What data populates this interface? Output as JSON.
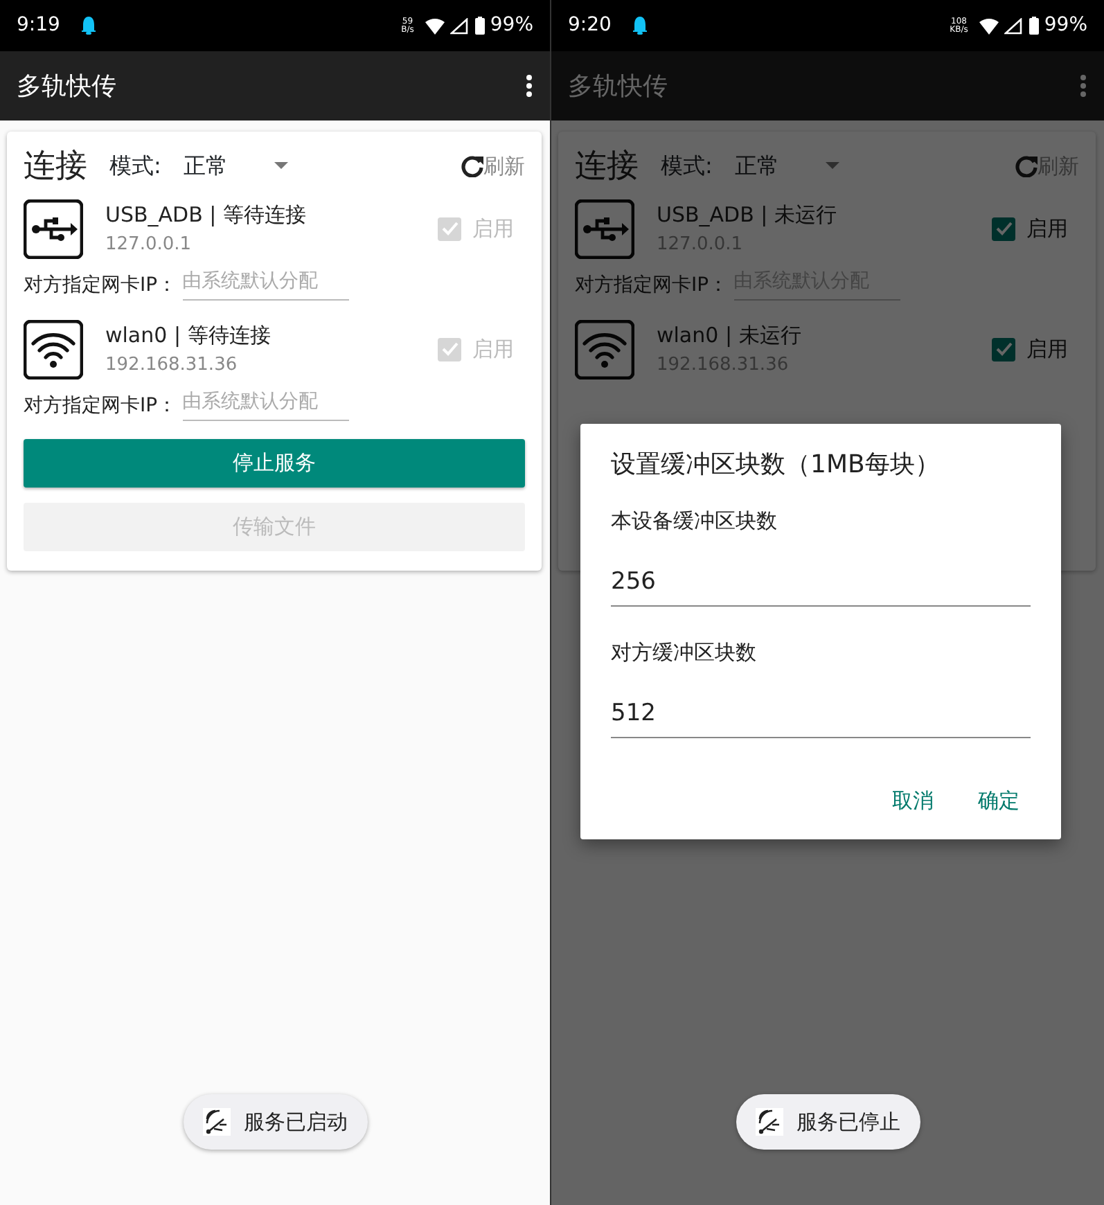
{
  "screens": [
    {
      "status_bar": {
        "time": "9:19",
        "speed": "59",
        "speed_unit": "B/s",
        "battery": "99%"
      },
      "app_bar": {
        "title": "多轨快传"
      },
      "card": {
        "title": "连接",
        "mode_label": "模式:",
        "mode_value": "正常",
        "refresh": "刷新",
        "devices": [
          {
            "kind": "usb",
            "name": "USB_ADB | 等待连接",
            "address": "127.0.0.1",
            "enable_label": "启用",
            "checked": true,
            "disabled": true,
            "ip_label": "对方指定网卡IP：",
            "ip_placeholder": "由系统默认分配"
          },
          {
            "kind": "wifi",
            "name": "wlan0 | 等待连接",
            "address": "192.168.31.36",
            "enable_label": "启用",
            "checked": true,
            "disabled": true,
            "ip_label": "对方指定网卡IP：",
            "ip_placeholder": "由系统默认分配"
          }
        ],
        "buttons": [
          {
            "kind": "primary",
            "label": "停止服务",
            "disabled": false
          },
          {
            "kind": "secondary",
            "label": "传输文件",
            "disabled": true
          }
        ]
      },
      "toast": {
        "text": "服务已启动"
      }
    },
    {
      "status_bar": {
        "time": "9:20",
        "speed": "108",
        "speed_unit": "KB/s",
        "battery": "99%"
      },
      "app_bar": {
        "title": "多轨快传"
      },
      "dimmed": true,
      "card": {
        "title": "连接",
        "mode_label": "模式:",
        "mode_value": "正常",
        "refresh": "刷新",
        "devices": [
          {
            "kind": "usb",
            "name": "USB_ADB | 未运行",
            "address": "127.0.0.1",
            "enable_label": "启用",
            "checked": true,
            "disabled": false,
            "ip_label": "对方指定网卡IP：",
            "ip_placeholder": "由系统默认分配"
          },
          {
            "kind": "wifi",
            "name": "wlan0 | 未运行",
            "address": "192.168.31.36",
            "enable_label": "启用",
            "checked": true,
            "disabled": false
          }
        ]
      },
      "dialog": {
        "title": "设置缓冲区块数（1MB每块）",
        "fields": [
          {
            "label": "本设备缓冲区块数",
            "value": "256"
          },
          {
            "label": "对方缓冲区块数",
            "value": "512"
          }
        ],
        "actions": [
          "取消",
          "确定"
        ]
      },
      "toast": {
        "text": "服务已停止"
      }
    }
  ]
}
